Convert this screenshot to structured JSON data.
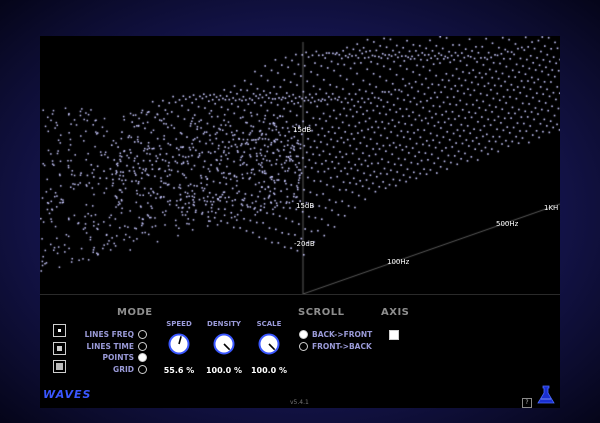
{
  "axis_labels": {
    "db_15": "15dB",
    "db_16": "15dB",
    "db_20": "-20dB",
    "hz_100": "100Hz",
    "hz_500": "500Hz",
    "khz_1": "1KH"
  },
  "mode": {
    "title": "MODE",
    "options": [
      {
        "label": "LINES FREQ",
        "selected": false
      },
      {
        "label": "LINES TIME",
        "selected": false
      },
      {
        "label": "POINTS",
        "selected": true
      },
      {
        "label": "GRID",
        "selected": false
      }
    ]
  },
  "view_buttons": [
    "view-single",
    "view-dual",
    "view-full"
  ],
  "knobs": [
    {
      "label": "SPEED",
      "value": "55.6 %",
      "level": 0.556
    },
    {
      "label": "DENSITY",
      "value": "100.0 %",
      "level": 1.0
    },
    {
      "label": "SCALE",
      "value": "100.0 %",
      "level": 1.0
    }
  ],
  "scroll": {
    "title": "SCROLL",
    "options": [
      {
        "label": "BACK->FRONT",
        "selected": true
      },
      {
        "label": "FRONT->BACK",
        "selected": false
      }
    ]
  },
  "axis": {
    "title": "AXIS",
    "checked": true
  },
  "footer": {
    "brand": "WAVES",
    "version": "v5.4.1",
    "help": "?"
  },
  "colors": {
    "points": "#c8c8ff",
    "accent": "#3a57ff",
    "label": "#9a9ad8"
  }
}
